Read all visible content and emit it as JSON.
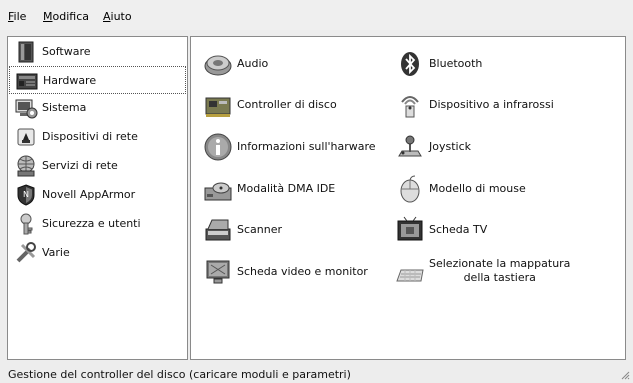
{
  "menu": {
    "file": {
      "accel": "F",
      "rest": "ile"
    },
    "modifica": {
      "accel": "M",
      "rest": "odifica"
    },
    "aiuto": {
      "accel": "A",
      "rest": "iuto"
    }
  },
  "sidebar": {
    "items": [
      {
        "label": "Software",
        "icon": "software-icon"
      },
      {
        "label": "Hardware",
        "icon": "hardware-icon",
        "selected": true
      },
      {
        "label": "Sistema",
        "icon": "system-icon"
      },
      {
        "label": "Dispositivi di rete",
        "icon": "network-devices-icon"
      },
      {
        "label": "Servizi di rete",
        "icon": "network-services-icon"
      },
      {
        "label": "Novell AppArmor",
        "icon": "apparmor-icon"
      },
      {
        "label": "Sicurezza e utenti",
        "icon": "security-users-icon"
      },
      {
        "label": "Varie",
        "icon": "misc-icon"
      }
    ]
  },
  "modules": [
    {
      "label": "Audio",
      "icon": "audio-icon"
    },
    {
      "label": "Bluetooth",
      "icon": "bluetooth-icon"
    },
    {
      "label": "Controller di disco",
      "icon": "disk-controller-icon"
    },
    {
      "label": "Dispositivo a infrarossi",
      "icon": "infrared-icon"
    },
    {
      "label": "Informazioni sull'harware",
      "icon": "hardware-info-icon"
    },
    {
      "label": "Joystick",
      "icon": "joystick-icon"
    },
    {
      "label": "Modalità DMA IDE",
      "icon": "ide-dma-icon"
    },
    {
      "label": "Modello di mouse",
      "icon": "mouse-icon"
    },
    {
      "label": "Scanner",
      "icon": "scanner-icon"
    },
    {
      "label": "Scheda TV",
      "icon": "tv-card-icon"
    },
    {
      "label": "Scheda video e monitor",
      "icon": "video-monitor-icon"
    },
    {
      "label_line1": "Selezionate la mappatura",
      "label_line2": "della tastiera",
      "icon": "keyboard-icon"
    }
  ],
  "status": {
    "text": "Gestione del controller del disco (caricare moduli e parametri)"
  }
}
